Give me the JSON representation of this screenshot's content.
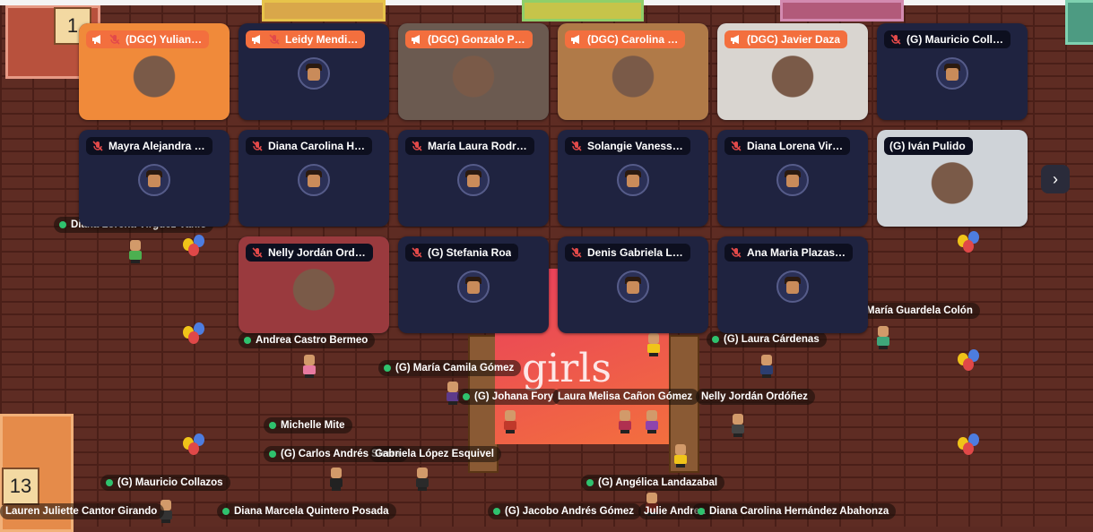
{
  "colors": {
    "speaker": "#f36f3e",
    "tile_bg": "#1f2340",
    "online": "#2fc26e",
    "brick": "#5e2c23"
  },
  "tables": {
    "t1": "1",
    "t13": "13"
  },
  "video_grid": {
    "next_label": "›",
    "tiles": [
      {
        "name": "(DGC) Yulian…",
        "speaker": true,
        "muted": true,
        "video": "#f08a3a"
      },
      {
        "name": "Leidy Mendi…",
        "speaker": true,
        "muted": true,
        "video": ""
      },
      {
        "name": "(DGC) Gonzalo P…",
        "speaker": true,
        "muted": false,
        "video": "#6b5a50"
      },
      {
        "name": "(DGC) Carolina …",
        "speaker": true,
        "muted": false,
        "video": "#b07a48"
      },
      {
        "name": "(DGC) Javier Daza",
        "speaker": true,
        "muted": false,
        "video": "#d9d5d0"
      },
      {
        "name": "(G) Mauricio Coll…",
        "speaker": false,
        "muted": true,
        "video": ""
      },
      {
        "name": "Mayra Alejandra …",
        "speaker": false,
        "muted": true,
        "video": ""
      },
      {
        "name": "Diana Carolina H…",
        "speaker": false,
        "muted": true,
        "video": ""
      },
      {
        "name": "María Laura Rodr…",
        "speaker": false,
        "muted": true,
        "video": ""
      },
      {
        "name": "Solangie Vaness…",
        "speaker": false,
        "muted": true,
        "video": ""
      },
      {
        "name": "Diana Lorena Vir…",
        "speaker": false,
        "muted": true,
        "video": ""
      },
      {
        "name": "(G) Iván Pulido",
        "speaker": false,
        "muted": false,
        "video": "#cfd3d8"
      },
      {
        "name": "Nelly Jordán Ord…",
        "speaker": false,
        "muted": true,
        "video": "#9a3a3e"
      },
      {
        "name": "(G) Stefania Roa",
        "speaker": false,
        "muted": true,
        "video": ""
      },
      {
        "name": "Denis Gabriela L…",
        "speaker": false,
        "muted": true,
        "video": ""
      },
      {
        "name": "Ana Maria Plazas…",
        "speaker": false,
        "muted": true,
        "video": ""
      }
    ]
  },
  "map_tags": [
    "Diana Lorena Virguez Vanio",
    "Andrea Castro Bermeo",
    "(G) María Camila Gómez",
    "(G) Johana Fory",
    "Laura Melisa Cañon Gómez",
    "Nelly Jordán Ordóñez",
    "María Guardela Colón",
    "(G) Laura Cárdenas",
    "Michelle Mite",
    "(G) Carlos Andrés Sierra",
    "Gabriela López Esquivel",
    "(G) Mauricio Collazos",
    "(G) Angélica Landazabal",
    "Lauren Juliette Cantor Girando",
    "Diana Marcela Quintero Posada",
    "(G) Jacobo Andrés Gómez",
    "Julie Andrea",
    "Diana Carolina Hernández Abahonza"
  ],
  "stage_logo": "girls"
}
